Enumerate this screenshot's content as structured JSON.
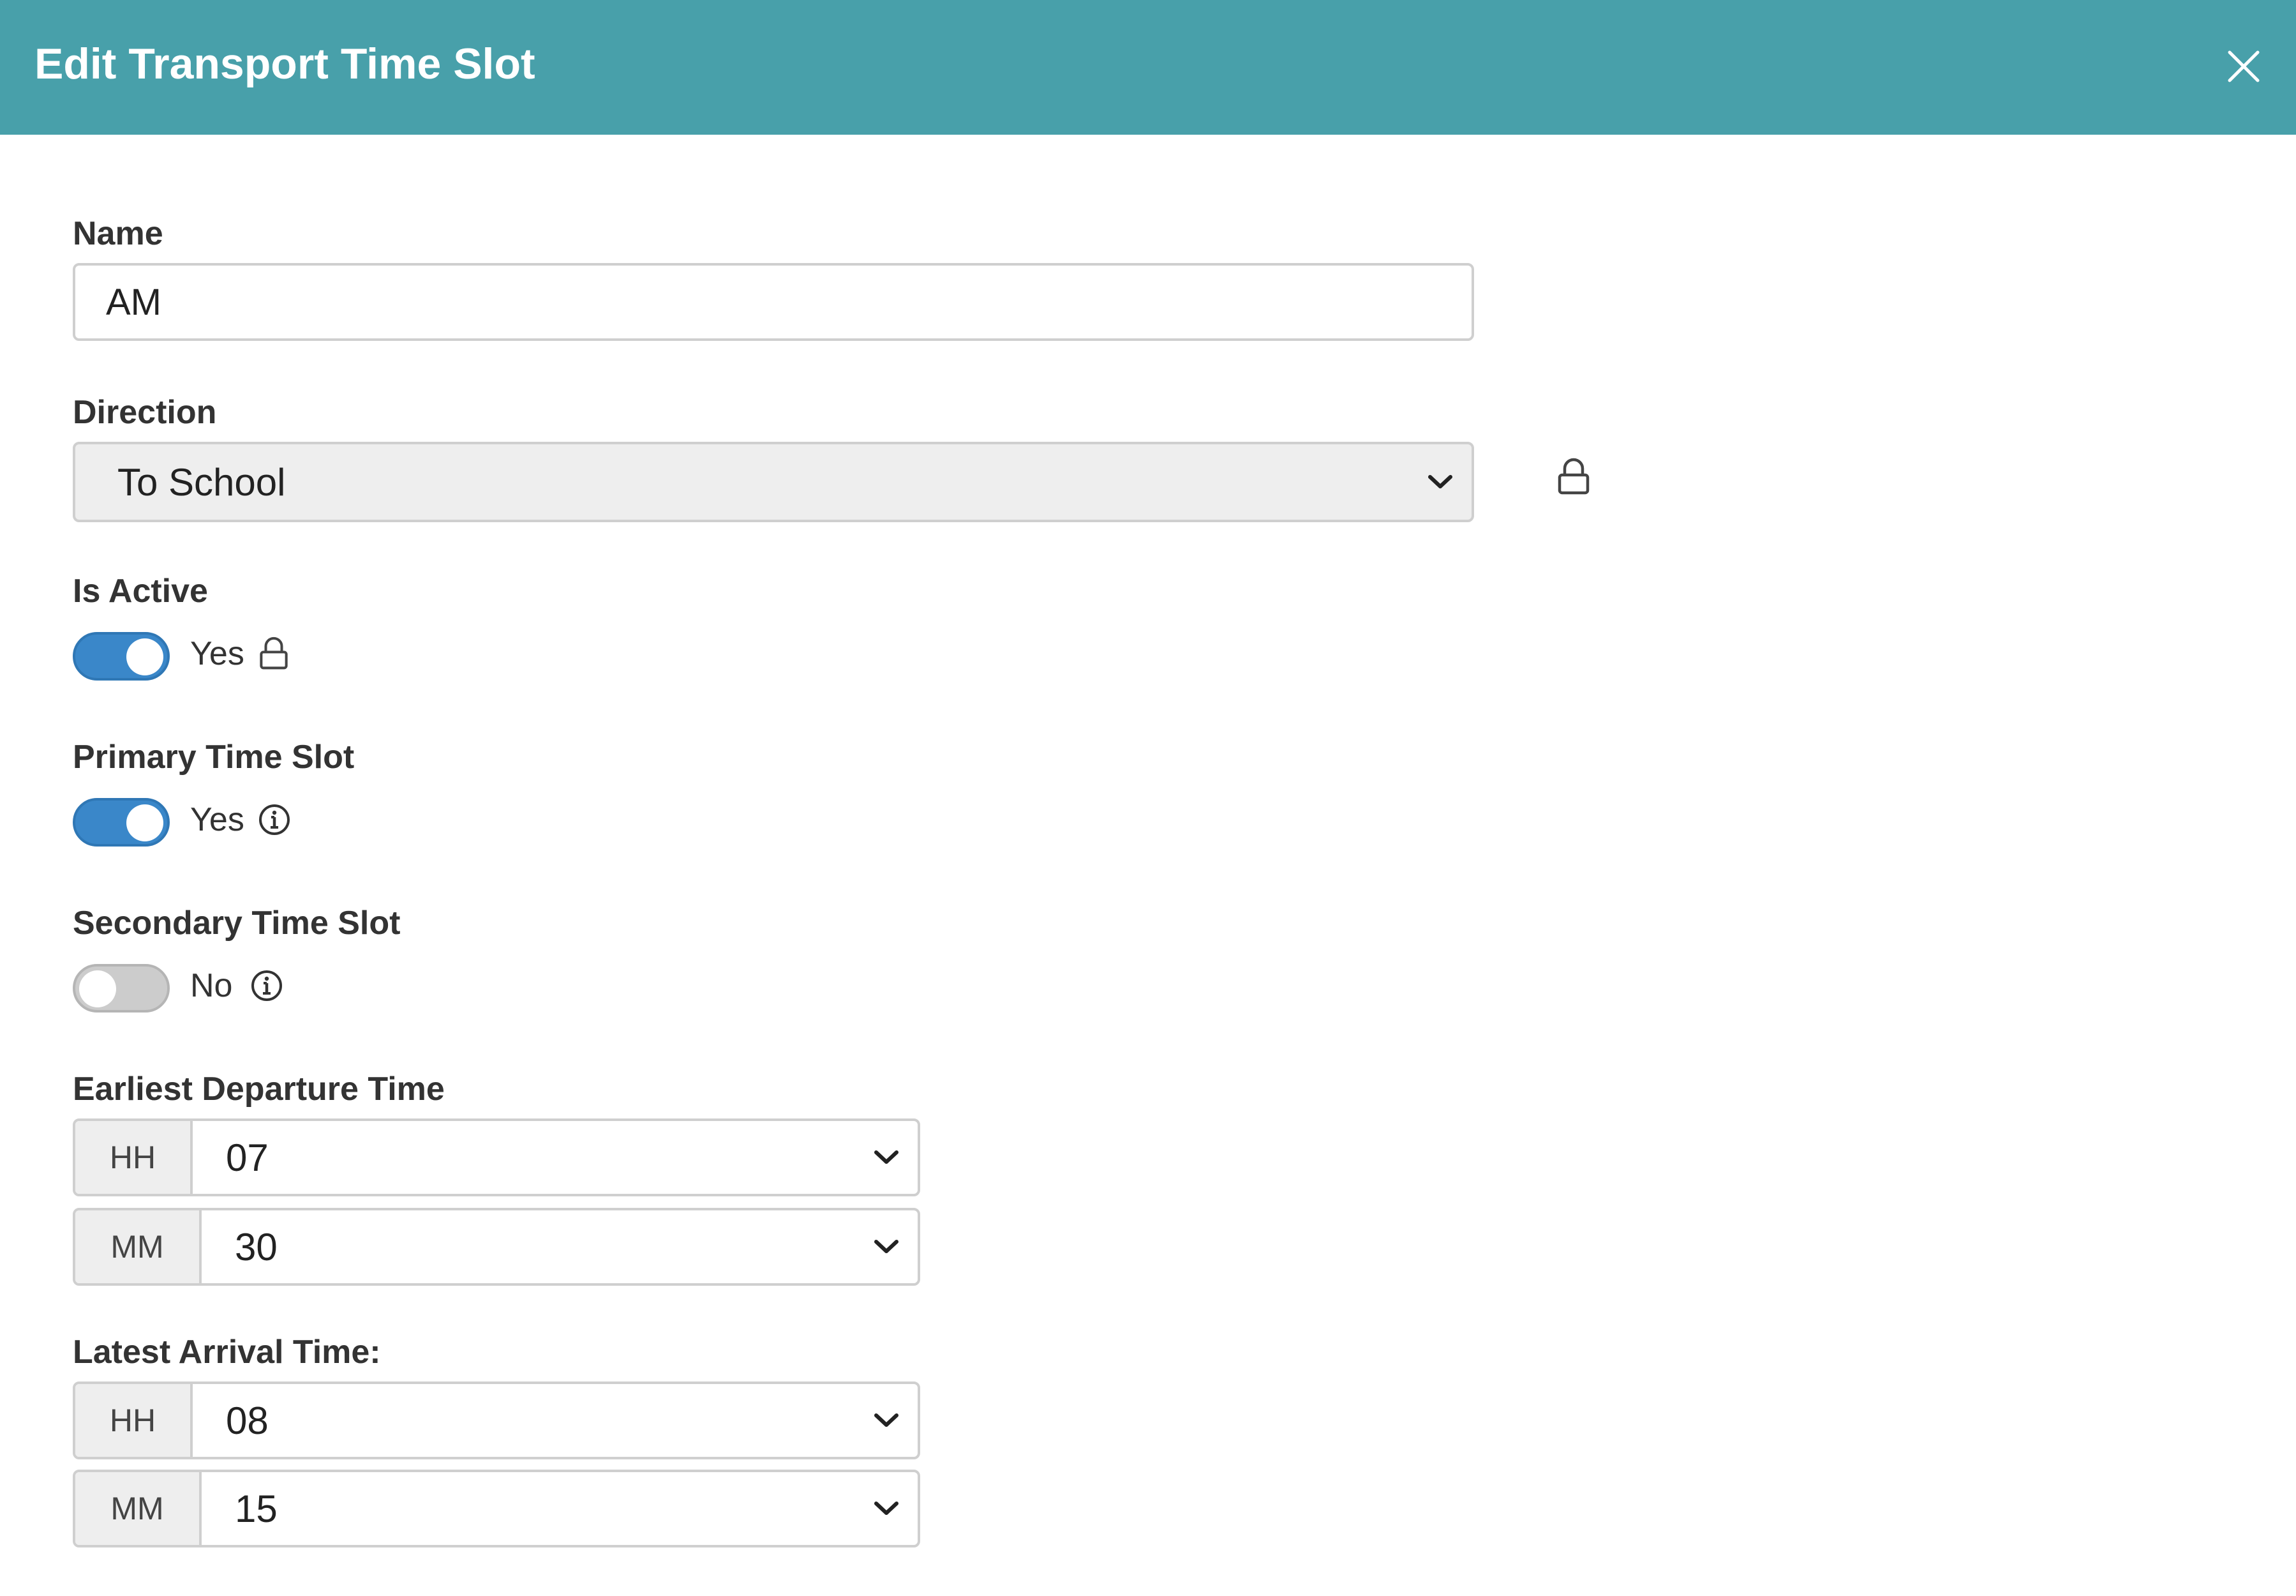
{
  "dialog": {
    "title": "Edit Transport Time Slot",
    "close_icon": "close-icon"
  },
  "form": {
    "name": {
      "label": "Name",
      "value": "AM"
    },
    "direction": {
      "label": "Direction",
      "value": "To School",
      "locked": true
    },
    "is_active": {
      "label": "Is Active",
      "state": "Yes",
      "on": true,
      "locked": true
    },
    "primary_time_slot": {
      "label": "Primary Time Slot",
      "state": "Yes",
      "on": true,
      "has_info": true
    },
    "secondary_time_slot": {
      "label": "Secondary Time Slot",
      "state": "No",
      "on": false,
      "has_info": true
    },
    "earliest_departure": {
      "label": "Earliest Departure Time",
      "hh_label": "HH",
      "hh_value": "07",
      "mm_label": "MM",
      "mm_value": "30"
    },
    "latest_arrival": {
      "label": "Latest Arrival Time:",
      "hh_label": "HH",
      "hh_value": "08",
      "mm_label": "MM",
      "mm_value": "15"
    }
  },
  "colors": {
    "header_bg": "#48a0aa",
    "toggle_on": "#3a87c9",
    "toggle_off": "#cccccc"
  }
}
